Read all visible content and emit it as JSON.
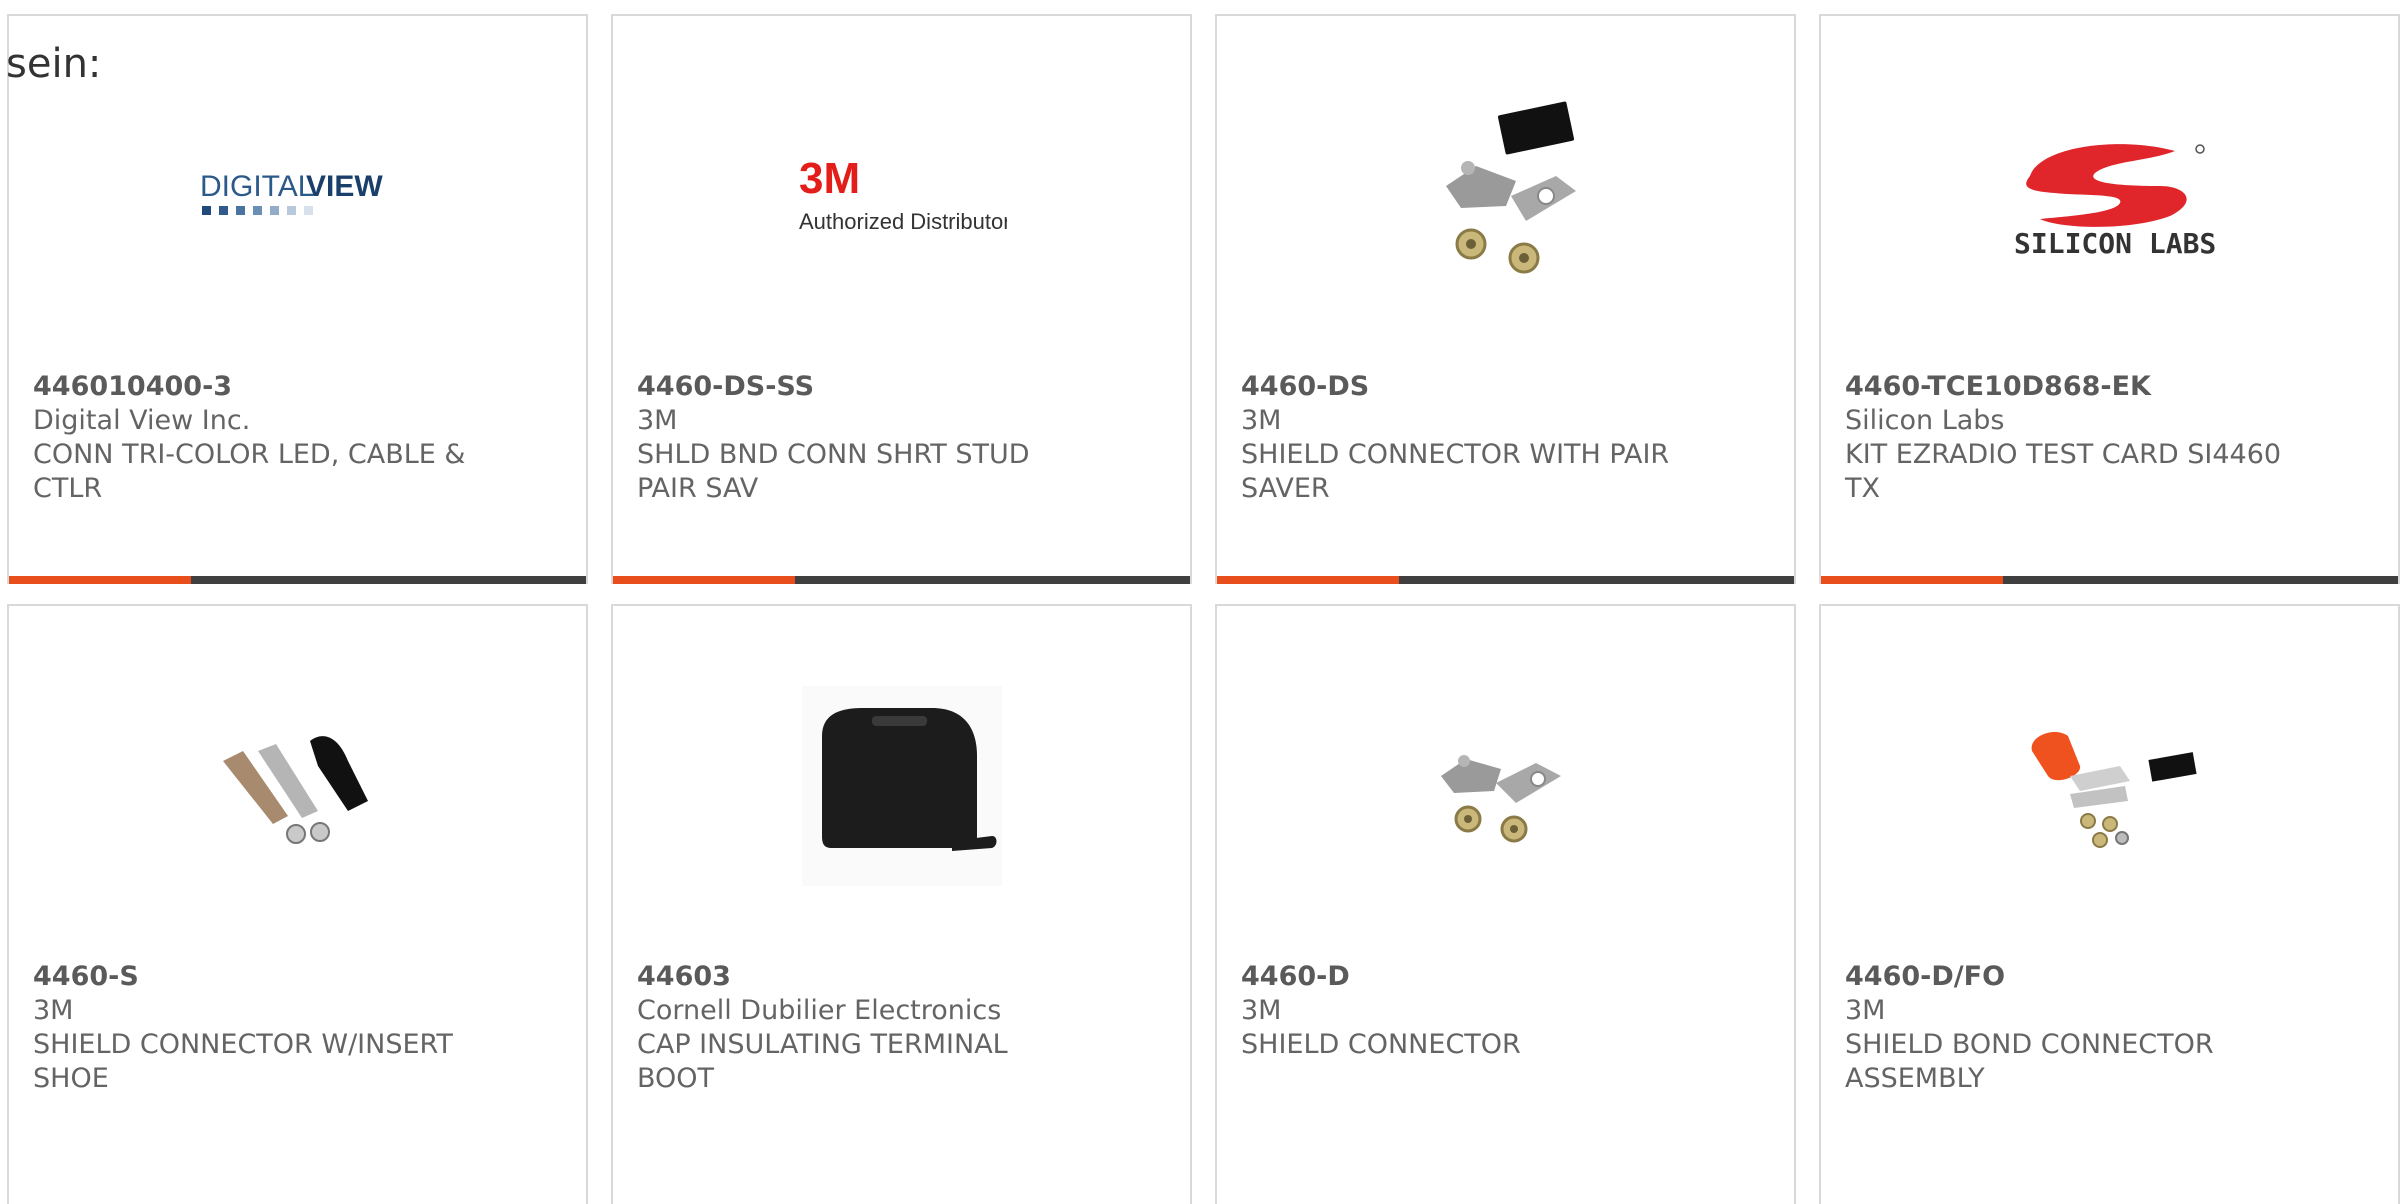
{
  "heading": "sein:",
  "products": [
    {
      "part_number": "446010400-3",
      "manufacturer": "Digital View Inc.",
      "description_line1": "CONN TRI-COLOR LED, CABLE &",
      "description_line2": "CTLR",
      "image": "digital-view-logo",
      "logo_text_a": "DIGITAL",
      "logo_text_b": "VIEW"
    },
    {
      "part_number": "4460-DS-SS",
      "manufacturer": "3M",
      "description_line1": "SHLD BND CONN SHRT STUD",
      "description_line2": "PAIR SAV",
      "image": "3m-authorized-distributor-logo",
      "logo_text_a": "3M",
      "logo_text_b": "Authorized Distributor"
    },
    {
      "part_number": "4460-DS",
      "manufacturer": "3M",
      "description_line1": "SHIELD CONNECTOR WITH PAIR",
      "description_line2": "SAVER",
      "image": "shield-connector-pair-saver-photo"
    },
    {
      "part_number": "4460-TCE10D868-EK",
      "manufacturer": "Silicon Labs",
      "description_line1": "KIT EZRADIO TEST CARD SI4460",
      "description_line2": "TX",
      "image": "silicon-labs-logo",
      "logo_text_a": "SILICON LABS"
    },
    {
      "part_number": "4460-S",
      "manufacturer": "3M",
      "description_line1": "SHIELD CONNECTOR W/INSERT",
      "description_line2": "SHOE",
      "image": "shield-connector-insert-shoe-photo"
    },
    {
      "part_number": "44603",
      "manufacturer": "Cornell Dubilier Electronics",
      "description_line1": "CAP INSULATING TERMINAL",
      "description_line2": "BOOT",
      "image": "insulating-terminal-boot-photo"
    },
    {
      "part_number": "4460-D",
      "manufacturer": "3M",
      "description_line1": "SHIELD CONNECTOR",
      "description_line2": "",
      "image": "shield-connector-photo"
    },
    {
      "part_number": "4460-D/FO",
      "manufacturer": "3M",
      "description_line1": "SHIELD BOND CONNECTOR",
      "description_line2": "ASSEMBLY",
      "image": "shield-bond-connector-assembly-photo"
    }
  ],
  "colors": {
    "accent": "#e84d1c",
    "bar": "#3f3f3f",
    "border": "#d9d9d9",
    "text": "#646464"
  }
}
